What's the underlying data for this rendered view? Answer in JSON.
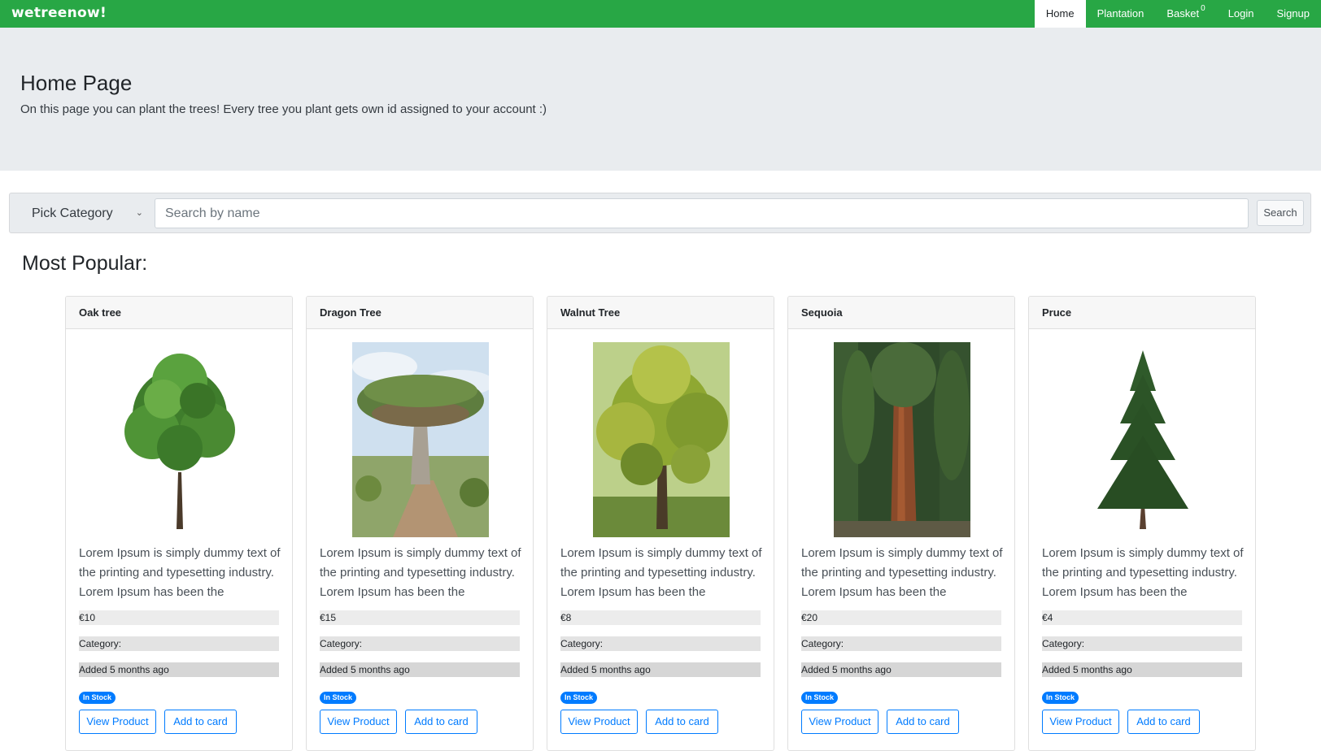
{
  "navbar": {
    "brand": "wetreenow!",
    "items": [
      {
        "label": "Home",
        "active": true
      },
      {
        "label": "Plantation",
        "active": false
      },
      {
        "label": "Basket",
        "badge": "0",
        "active": false
      },
      {
        "label": "Login",
        "active": false
      },
      {
        "label": "Signup",
        "active": false
      }
    ],
    "color": "#28a745"
  },
  "jumbotron": {
    "title": "Home Page",
    "subtitle": "On this page you can plant the trees! Every tree you plant gets own id assigned to your account :)"
  },
  "search": {
    "category_label": "Pick Category",
    "placeholder": "Search by name",
    "button_label": "Search"
  },
  "section_title": "Most Popular:",
  "products": [
    {
      "name": "Oak tree",
      "description": "Lorem Ipsum is simply dummy text of the printing and typesetting industry. Lorem Ipsum has been the",
      "price": "€10",
      "category": "Category:",
      "added": "Added 5 months ago",
      "stock": "In Stock",
      "view_label": "View Product",
      "add_label": "Add to card",
      "image": "oak-tree-image"
    },
    {
      "name": "Dragon Tree",
      "description": "Lorem Ipsum is simply dummy text of the printing and typesetting industry. Lorem Ipsum has been the",
      "price": "€15",
      "category": "Category:",
      "added": "Added 5 months ago",
      "stock": "In Stock",
      "view_label": "View Product",
      "add_label": "Add to card",
      "image": "dragon-tree-image"
    },
    {
      "name": "Walnut Tree",
      "description": "Lorem Ipsum is simply dummy text of the printing and typesetting industry. Lorem Ipsum has been the",
      "price": "€8",
      "category": "Category:",
      "added": "Added 5 months ago",
      "stock": "In Stock",
      "view_label": "View Product",
      "add_label": "Add to card",
      "image": "walnut-tree-image"
    },
    {
      "name": "Sequoia",
      "description": "Lorem Ipsum is simply dummy text of the printing and typesetting industry. Lorem Ipsum has been the",
      "price": "€20",
      "category": "Category:",
      "added": "Added 5 months ago",
      "stock": "In Stock",
      "view_label": "View Product",
      "add_label": "Add to card",
      "image": "sequoia-image"
    },
    {
      "name": "Pruce",
      "description": "Lorem Ipsum is simply dummy text of the printing and typesetting industry. Lorem Ipsum has been the",
      "price": "€4",
      "category": "Category:",
      "added": "Added 5 months ago",
      "stock": "In Stock",
      "view_label": "View Product",
      "add_label": "Add to card",
      "image": "spruce-image"
    }
  ]
}
